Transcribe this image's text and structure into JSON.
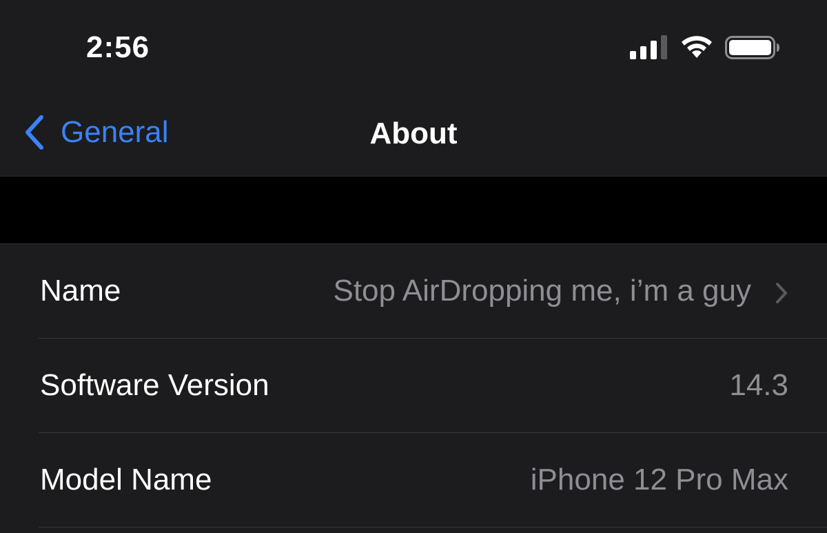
{
  "status_bar": {
    "time": "2:56",
    "icons": [
      "signal-icon",
      "wifi-icon",
      "battery-icon"
    ]
  },
  "nav": {
    "back_label": "General",
    "title": "About"
  },
  "rows": [
    {
      "label": "Name",
      "value": "Stop AirDropping me, i’m a guy",
      "has_chevron": true
    },
    {
      "label": "Software Version",
      "value": "14.3",
      "has_chevron": false
    },
    {
      "label": "Model Name",
      "value": "iPhone 12 Pro Max",
      "has_chevron": false
    }
  ],
  "colors": {
    "background": "#1c1c1e",
    "gap": "#000000",
    "accent": "#3b82f6",
    "secondary_text": "#8e8e93",
    "separator": "#38383a"
  }
}
